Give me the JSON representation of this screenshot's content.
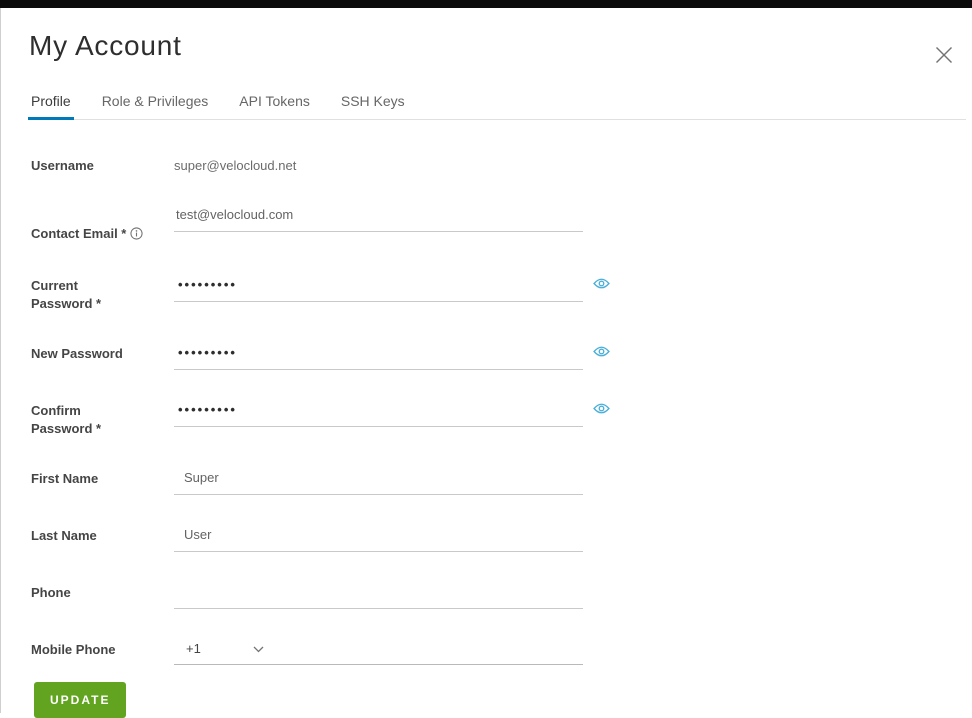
{
  "modal": {
    "title": "My Account",
    "close_icon": "x-icon"
  },
  "tabs": {
    "items": [
      {
        "label": "Profile",
        "active": true
      },
      {
        "label": "Role & Privileges",
        "active": false
      },
      {
        "label": "API Tokens",
        "active": false
      },
      {
        "label": "SSH Keys",
        "active": false
      }
    ]
  },
  "form": {
    "username": {
      "label": "Username",
      "value": "super@velocloud.net"
    },
    "contact_email": {
      "label": "Contact Email *",
      "info_icon": "info-circle-icon",
      "value": "test@velocloud.com"
    },
    "current_password": {
      "label": "Current\nPassword *",
      "value": "•••••••••",
      "toggle_icon": "eye-icon"
    },
    "new_password": {
      "label": "New Password",
      "value": "•••••••••",
      "toggle_icon": "eye-icon"
    },
    "confirm_password": {
      "label": "Confirm\nPassword *",
      "value": "•••••••••",
      "toggle_icon": "eye-icon"
    },
    "first_name": {
      "label": "First Name",
      "value": "Super"
    },
    "last_name": {
      "label": "Last Name",
      "value": "User"
    },
    "phone": {
      "label": "Phone",
      "value": ""
    },
    "mobile_phone": {
      "label": "Mobile Phone",
      "country_code": "+1",
      "value": "",
      "dropdown_icon": "chevron-down-icon"
    }
  },
  "actions": {
    "update_label": "UPDATE"
  },
  "colors": {
    "accent_blue": "#0079b8",
    "eye_icon_blue": "#49afd9",
    "update_green": "#62a420",
    "topbar_black": "#0b0b0b",
    "underline_gray": "#c9c9c9"
  }
}
